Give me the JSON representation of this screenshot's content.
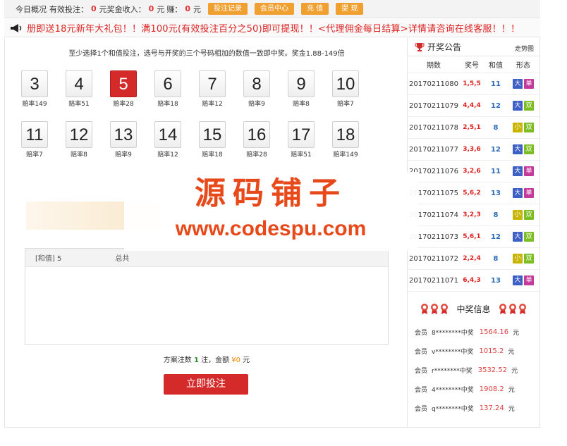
{
  "topbar": {
    "overview_label": "今日概况",
    "valid_bet_label": "有效投注：",
    "valid_bet_value": "0",
    "currency": "元",
    "bonus_label": "奖金收入：",
    "bonus_value": "0",
    "profit_label": "赚：",
    "profit_value": "0",
    "buttons": [
      "投注记录",
      "会员中心",
      "充 值",
      "提 现"
    ]
  },
  "notice": {
    "text": "册即送18元新年大礼包！！满100元(有效投注百分之50)即可提现！！<代理佣金每日结算>详情请咨询在线客服！！！"
  },
  "main": {
    "hint": "至少选择1个和值投注，选号与开奖的三个号码相加的数值一致即中奖。奖金1.88-149倍",
    "odds_prefix": "赔率",
    "numbers": [
      {
        "n": "3",
        "odds": "赔率149"
      },
      {
        "n": "4",
        "odds": "赔率51"
      },
      {
        "n": "5",
        "odds": "赔率28"
      },
      {
        "n": "6",
        "odds": "赔率18"
      },
      {
        "n": "7",
        "odds": "赔率12"
      },
      {
        "n": "8",
        "odds": "赔率9"
      },
      {
        "n": "9",
        "odds": "赔率8"
      },
      {
        "n": "10",
        "odds": "赔率7"
      },
      {
        "n": "11",
        "odds": "赔率7"
      },
      {
        "n": "12",
        "odds": "赔率8"
      },
      {
        "n": "13",
        "odds": "赔率9"
      },
      {
        "n": "14",
        "odds": "赔率12"
      },
      {
        "n": "15",
        "odds": "赔率18"
      },
      {
        "n": "16",
        "odds": "赔率28"
      },
      {
        "n": "17",
        "odds": "赔率51"
      },
      {
        "n": "18",
        "odds": "赔率149"
      }
    ],
    "selected": "5",
    "order": {
      "item": "[和值] 5",
      "total_label": "总共"
    },
    "summary": {
      "prefix": "方案注数",
      "count": "1",
      "mid": "注，金额",
      "amount": "¥0",
      "suffix": "元"
    },
    "submit_label": "立即投注"
  },
  "watermark": {
    "line1": "源码铺子",
    "line2": "www.codespu.com"
  },
  "sidebar": {
    "announce_title": "开奖公告",
    "trend_link": "走势图",
    "columns": [
      "期数",
      "奖号",
      "和值",
      "形态"
    ],
    "rows": [
      {
        "issue": "20170211080",
        "nums": "1,5,5",
        "sum": "11",
        "size": "大",
        "parity": "单"
      },
      {
        "issue": "20170211079",
        "nums": "4,4,4",
        "sum": "12",
        "size": "大",
        "parity": "双"
      },
      {
        "issue": "20170211078",
        "nums": "2,5,1",
        "sum": "8",
        "size": "小",
        "parity": "双"
      },
      {
        "issue": "20170211077",
        "nums": "3,3,6",
        "sum": "12",
        "size": "大",
        "parity": "双"
      },
      {
        "issue": "20170211076",
        "nums": "3,2,6",
        "sum": "11",
        "size": "大",
        "parity": "单"
      },
      {
        "issue": "20170211075",
        "nums": "5,6,2",
        "sum": "13",
        "size": "大",
        "parity": "单"
      },
      {
        "issue": "20170211074",
        "nums": "3,2,3",
        "sum": "8",
        "size": "小",
        "parity": "双"
      },
      {
        "issue": "20170211073",
        "nums": "5,6,1",
        "sum": "12",
        "size": "大",
        "parity": "双"
      },
      {
        "issue": "20170211072",
        "nums": "2,2,4",
        "sum": "8",
        "size": "小",
        "parity": "双"
      },
      {
        "issue": "20170211071",
        "nums": "6,4,3",
        "sum": "13",
        "size": "大",
        "parity": "单"
      }
    ],
    "winners_title": "中奖信息",
    "member_label": "会员",
    "win_label": "中奖",
    "unit": "元",
    "winners": [
      {
        "user": "8********",
        "amount": "1564.16"
      },
      {
        "user": "v********",
        "amount": "1015.2"
      },
      {
        "user": "r********",
        "amount": "3532.52"
      },
      {
        "user": "4********",
        "amount": "1908.2"
      },
      {
        "user": "q********",
        "amount": "137.24"
      }
    ]
  },
  "colors": {
    "accent_red": "#d42a2a",
    "orange_button": "#f0a030",
    "big_tag": "#3e5fc4",
    "odd_tag": "#c43a9a",
    "small_tag": "#c7b500",
    "even_tag": "#7cbd23"
  },
  "icons": {
    "notice": "megaphone-icon",
    "announce": "trophy-icon",
    "winners": "medal-icon"
  }
}
